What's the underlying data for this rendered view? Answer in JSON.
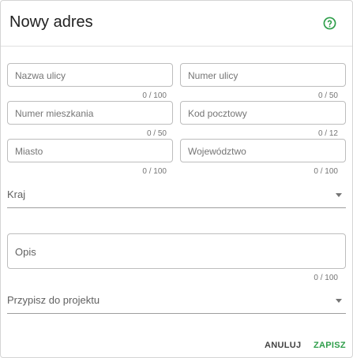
{
  "dialog": {
    "title": "Nowy adres",
    "help_icon": "help-circle-icon",
    "accent_color": "#2e9e4a"
  },
  "fields": {
    "street_name": {
      "placeholder": "Nazwa ulicy",
      "counter": "0 / 100"
    },
    "street_number": {
      "placeholder": "Numer ulicy",
      "counter": "0 / 50"
    },
    "apartment_number": {
      "placeholder": "Numer mieszkania",
      "counter": "0 / 50"
    },
    "postal_code": {
      "placeholder": "Kod pocztowy",
      "counter": "0 / 12"
    },
    "city": {
      "placeholder": "Miasto",
      "counter": "0 / 100"
    },
    "voivodeship": {
      "placeholder": "Województwo",
      "counter": "0 / 100"
    },
    "description": {
      "placeholder": "Opis",
      "counter": "0 / 100"
    }
  },
  "selects": {
    "country": {
      "label": "Kraj"
    },
    "project": {
      "label": "Przypisz do projektu"
    }
  },
  "actions": {
    "cancel_label": "ANULUJ",
    "save_label": "ZAPISZ"
  }
}
